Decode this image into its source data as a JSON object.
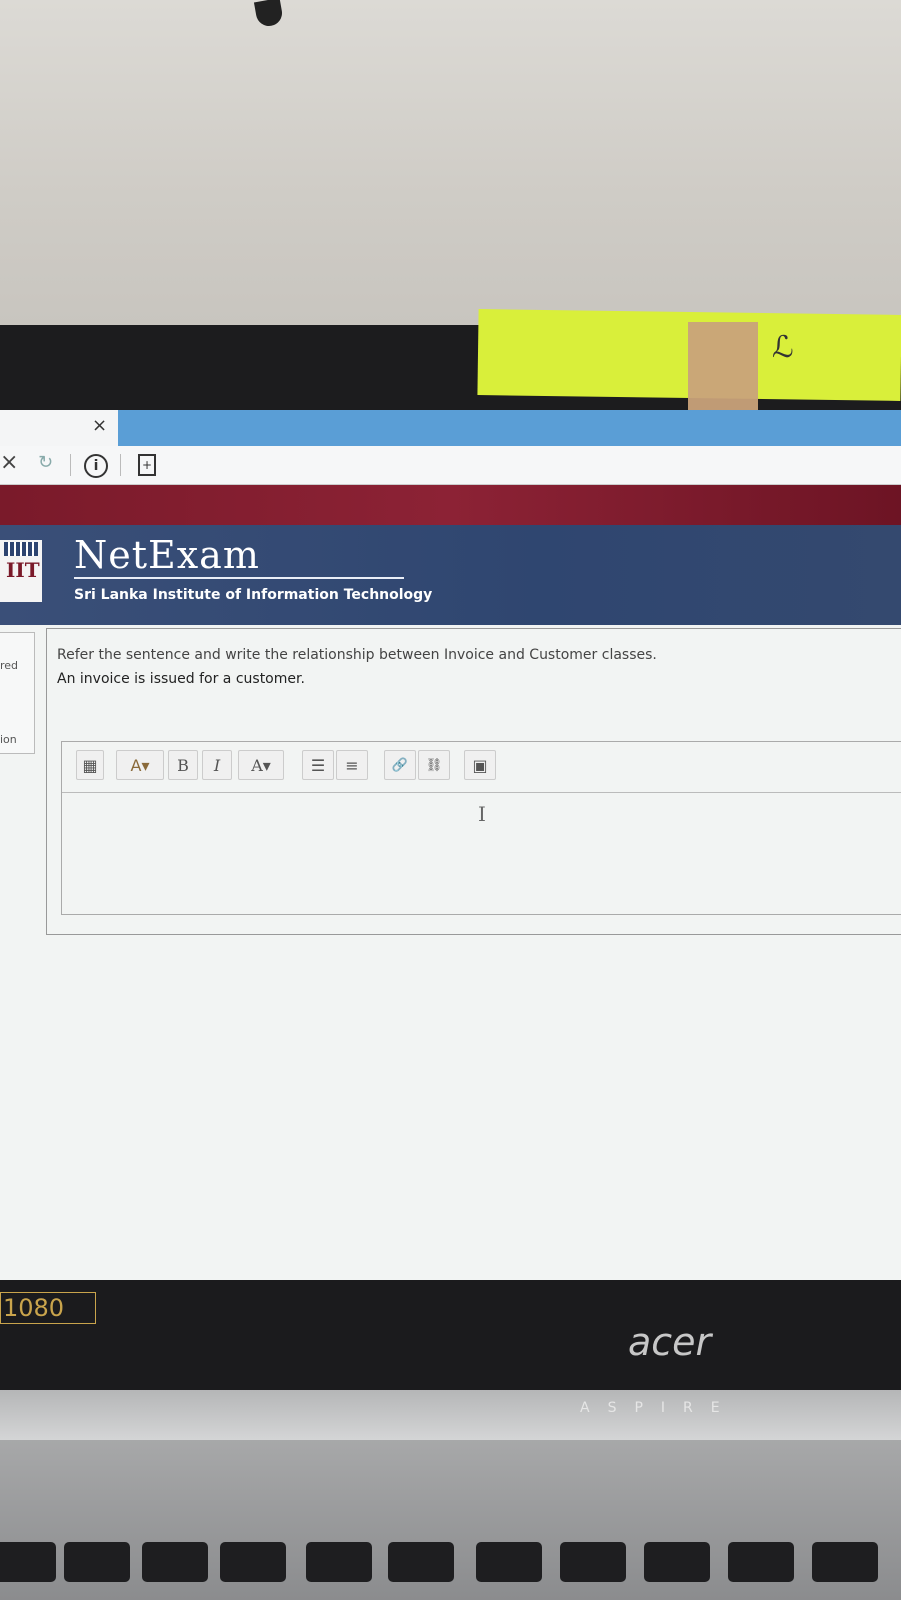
{
  "browser": {
    "tab_close": "×",
    "nav_stop": "×",
    "nav_reload": "↻",
    "nav_info": "i"
  },
  "header": {
    "logo_text": "IIT",
    "title": "NetExam",
    "subtitle": "Sri Lanka Institute of Information Technology"
  },
  "sidebar": {
    "label_1": "red",
    "label_2": "ion"
  },
  "question": {
    "prompt": "Refer the sentence and write the relationship between Invoice and Customer classes.",
    "sentence": "An invoice is issued for a customer."
  },
  "editor": {
    "toolbar": [
      {
        "name": "toolbar-toggle-button",
        "label": "▦"
      },
      {
        "name": "font-style-button",
        "label": "A▾"
      },
      {
        "name": "bold-button",
        "label": "B"
      },
      {
        "name": "italic-button",
        "label": "I"
      },
      {
        "name": "font-color-button",
        "label": "A▾"
      },
      {
        "name": "unordered-list-button",
        "label": "☰"
      },
      {
        "name": "ordered-list-button",
        "label": "≡"
      },
      {
        "name": "link-button",
        "label": "🔗"
      },
      {
        "name": "unlink-button",
        "label": "⛓"
      },
      {
        "name": "image-button",
        "label": "▣"
      }
    ],
    "content": "",
    "cursor": "I"
  },
  "device": {
    "resolution_badge": "1080",
    "brand": "acer",
    "model": "ASPIRE"
  },
  "colors": {
    "header_bg": "#2f4670",
    "red_band": "#7a1a2a",
    "tab_accent": "#5a9ed6"
  }
}
